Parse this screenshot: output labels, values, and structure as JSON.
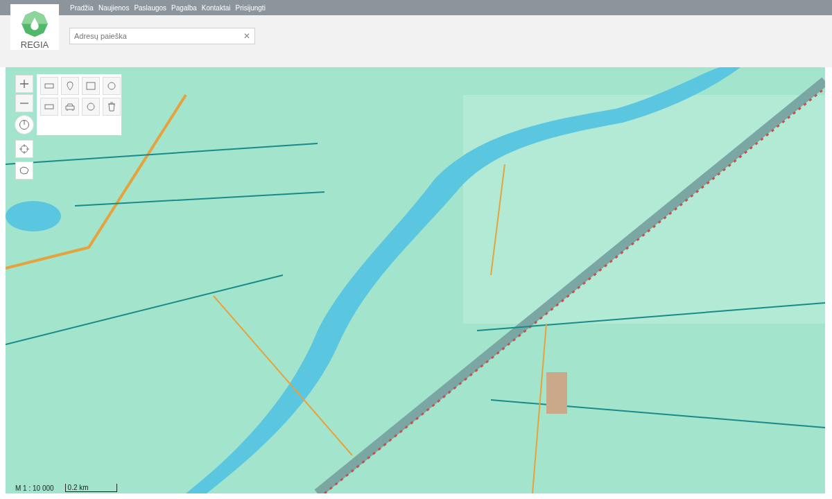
{
  "nav": [
    {
      "label": "Pradžia"
    },
    {
      "label": "Naujienos"
    },
    {
      "label": "Paslaugos"
    },
    {
      "label": "Pagalba"
    },
    {
      "label": "Kontaktai"
    },
    {
      "label": "Prisijungti"
    }
  ],
  "logo": {
    "text": "REGIA"
  },
  "search": {
    "placeholder": "Adresų paieška",
    "clear": "✕"
  },
  "scale": {
    "ratio": "M 1 : 10 000",
    "distance": "0.2 km"
  }
}
